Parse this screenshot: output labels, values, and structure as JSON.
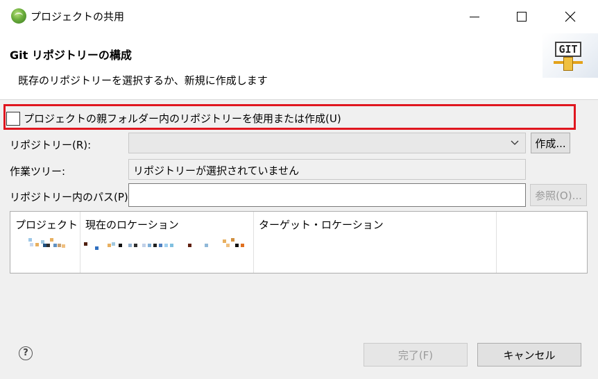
{
  "window": {
    "title": "プロジェクトの共用",
    "icon": "eclipse-app-icon"
  },
  "header": {
    "title": "Git リポジトリーの構成",
    "description": "既存のリポジトリーを選択するか、新規に作成します",
    "logo_text": "GIT"
  },
  "form": {
    "use_parent_checkbox_label": "プロジェクトの親フォルダー内のリポジトリーを使用または作成(U)",
    "use_parent_checked": false,
    "repository_label": "リポジトリー(R):",
    "repository_value": "",
    "create_button": "作成...",
    "worktree_label": "作業ツリー:",
    "worktree_value": "リポジトリーが選択されていません",
    "path_label": "リポジトリー内のパス(P):",
    "path_value": "",
    "browse_button": "参照(O)..."
  },
  "table": {
    "columns": [
      "プロジェクト",
      "現在のロケーション",
      "ターゲット・ロケーション"
    ]
  },
  "footer": {
    "help_icon": "help-icon",
    "finish_button": "完了(F)",
    "cancel_button": "キャンセル"
  },
  "colors": {
    "highlight": "#e0161f"
  }
}
